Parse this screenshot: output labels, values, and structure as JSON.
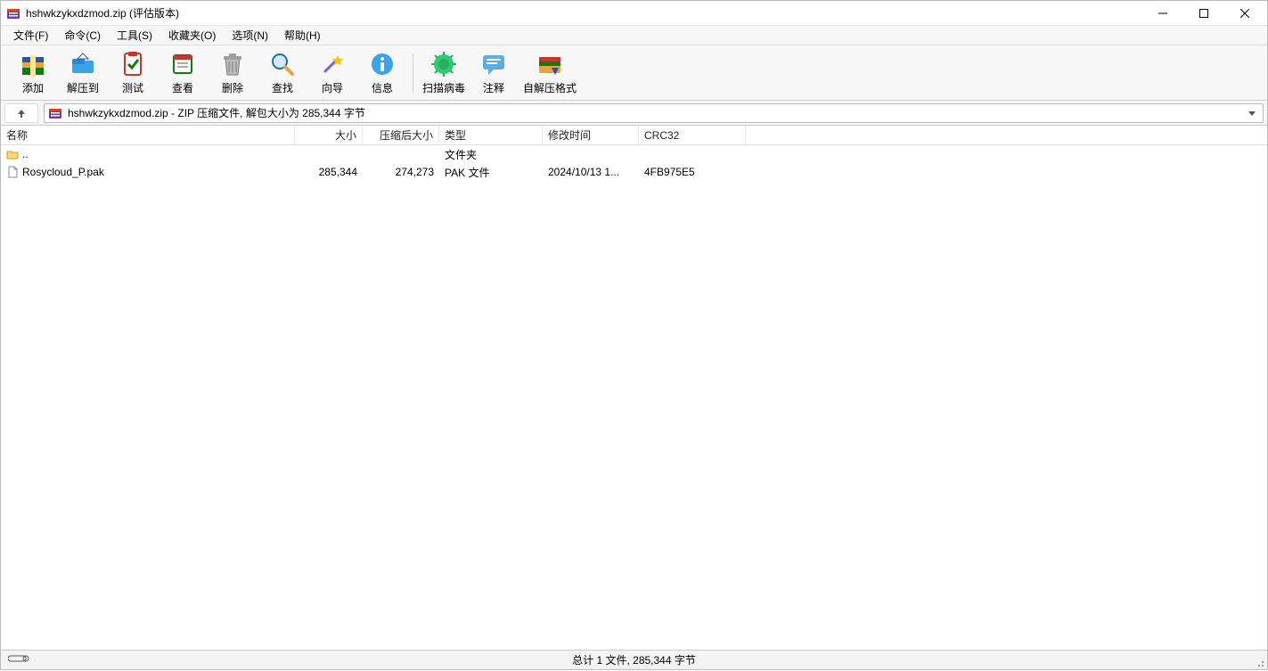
{
  "window": {
    "title": "hshwkzykxdzmod.zip (评估版本)"
  },
  "menu": {
    "items": [
      "文件(F)",
      "命令(C)",
      "工具(S)",
      "收藏夹(O)",
      "选项(N)",
      "帮助(H)"
    ]
  },
  "toolbar": {
    "items": [
      {
        "id": "add",
        "label": "添加"
      },
      {
        "id": "extract",
        "label": "解压到"
      },
      {
        "id": "test",
        "label": "测试"
      },
      {
        "id": "view",
        "label": "查看"
      },
      {
        "id": "delete",
        "label": "删除"
      },
      {
        "id": "find",
        "label": "查找"
      },
      {
        "id": "wizard",
        "label": "向导"
      },
      {
        "id": "info",
        "label": "信息"
      },
      {
        "id": "virus",
        "label": "扫描病毒"
      },
      {
        "id": "comment",
        "label": "注释"
      },
      {
        "id": "sfx",
        "label": "自解压格式"
      }
    ]
  },
  "address": {
    "text": "hshwkzykxdzmod.zip - ZIP 压缩文件, 解包大小为 285,344 字节"
  },
  "columns": {
    "name": "名称",
    "size": "大小",
    "packed": "压缩后大小",
    "type": "类型",
    "date": "修改时间",
    "crc": "CRC32"
  },
  "rows": [
    {
      "name": "..",
      "size": "",
      "packed": "",
      "type": "文件夹",
      "date": "",
      "crc": "",
      "is_up": true
    },
    {
      "name": "Rosycloud_P.pak",
      "size": "285,344",
      "packed": "274,273",
      "type": "PAK 文件",
      "date": "2024/10/13 1...",
      "crc": "4FB975E5",
      "is_up": false
    }
  ],
  "status": {
    "summary": "总计 1 文件, 285,344 字节"
  }
}
